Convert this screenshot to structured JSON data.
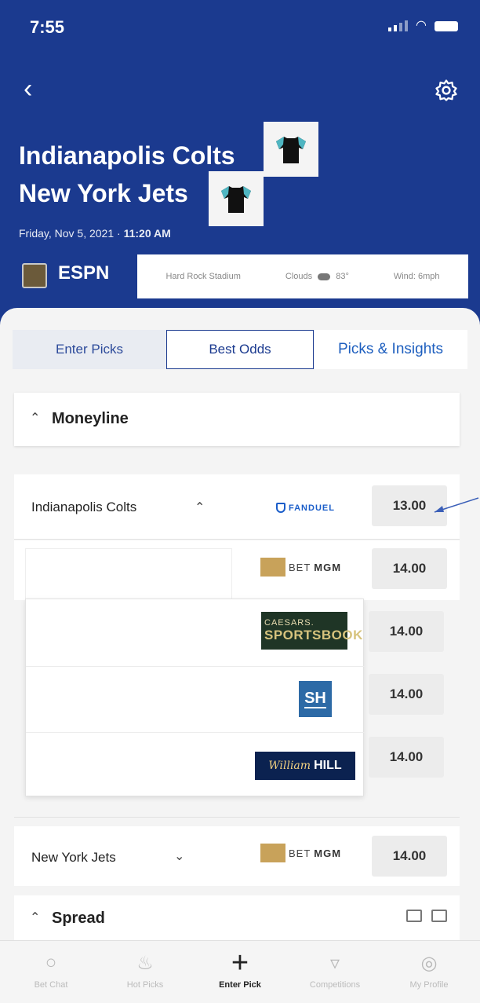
{
  "status_bar": {
    "time": "7:55"
  },
  "game": {
    "home_team": "Indianapolis Colts",
    "away_team": "New York Jets",
    "date": "Friday, Nov 5, 2021 · ",
    "time": "11:20 AM",
    "network": "ESPN",
    "venue": "Hard Rock Stadium",
    "weather": "Clouds",
    "temperature": "83°",
    "wind": "Wind: 6mph"
  },
  "tabs": [
    {
      "label": "Enter Picks"
    },
    {
      "label": "Best Odds"
    },
    {
      "label": "Picks & Insights"
    }
  ],
  "moneyline": {
    "title": "Moneyline",
    "team_row_label": "Indianapolis Colts",
    "top_book": "FANDUEL",
    "top_odds": "13.00",
    "betmgm_odds": "14.00",
    "books": [
      {
        "brand_line1": "CAESARS.",
        "brand_line2": "SPORTSBOOK",
        "odds": "14.00"
      },
      {
        "brand": "SH",
        "odds": "14.00"
      },
      {
        "brand_script": "William",
        "brand_bold": "HILL",
        "odds": "14.00"
      }
    ],
    "jets_row_label": "New York Jets",
    "jets_odds": "14.00"
  },
  "betmgm": {
    "bet": "BET",
    "mgm": "MGM"
  },
  "spread": {
    "title": "Spread"
  },
  "nav": [
    {
      "label": "Bet Chat",
      "icon": "chat-bubble-icon"
    },
    {
      "label": "Hot Picks",
      "icon": "flame-icon"
    },
    {
      "label": "Enter Pick",
      "icon": "plus-icon"
    },
    {
      "label": "Competitions",
      "icon": "trophy-icon"
    },
    {
      "label": "My Profile",
      "icon": "profile-icon"
    }
  ]
}
